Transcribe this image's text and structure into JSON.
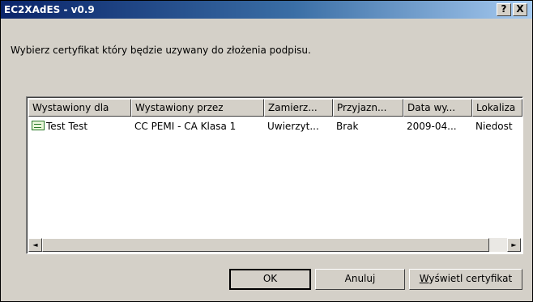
{
  "window": {
    "title": "EC2XAdES - v0.9",
    "help_label": "?",
    "close_label": "X"
  },
  "prompt": "Wybierz certyfikat który będzie uzywany do złożenia podpisu.",
  "table": {
    "columns": [
      "Wystawiony dla",
      "Wystawiony przez",
      "Zamierz...",
      "Przyjazn...",
      "Data wy...",
      "Lokaliza"
    ],
    "rows": [
      [
        "Test Test",
        "CC PEMI - CA Klasa 1",
        "Uwierzyt...",
        "Brak",
        "2009-04...",
        "Niedost"
      ]
    ]
  },
  "scrollbar": {
    "left_arrow": "◄",
    "right_arrow": "►"
  },
  "buttons": {
    "ok": "OK",
    "cancel": "Anuluj",
    "view_mnemonic": "W",
    "view_rest": "yświetl certyfikat"
  },
  "icons": {
    "certificate": "certificate-icon"
  }
}
